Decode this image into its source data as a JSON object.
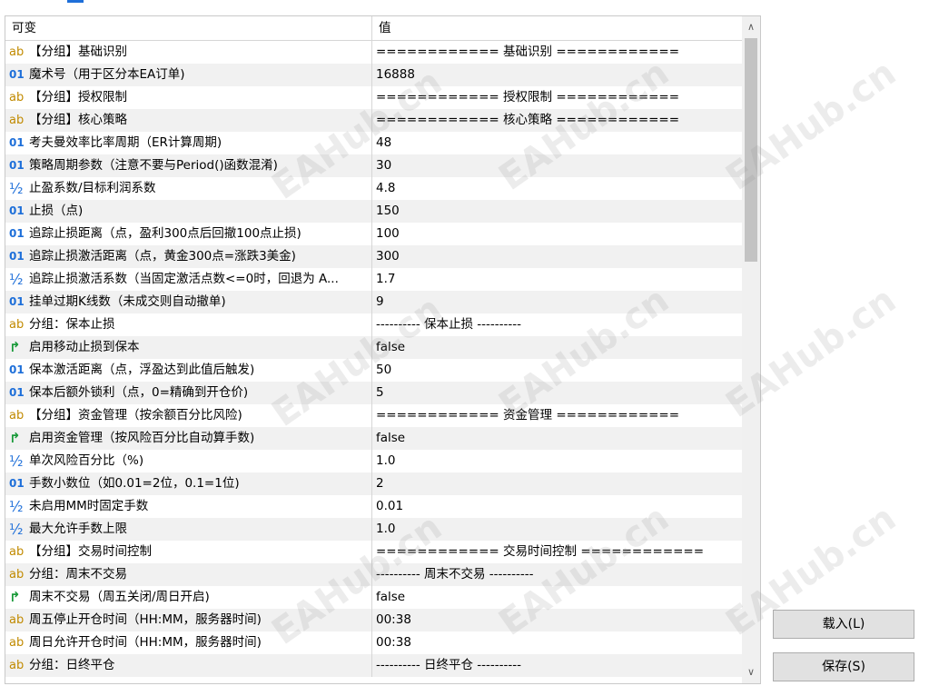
{
  "header": {
    "col_name": "可变",
    "col_value": "值"
  },
  "rows": [
    {
      "type": "ab",
      "icon": "string-icon",
      "name": "【分组】基础识别",
      "value": "============ 基础识别 ============"
    },
    {
      "type": "01",
      "icon": "integer-icon",
      "name": "魔术号（用于区分本EA订单)",
      "value": "16888"
    },
    {
      "type": "ab",
      "icon": "string-icon",
      "name": "【分组】授权限制",
      "value": "============ 授权限制 ============"
    },
    {
      "type": "ab",
      "icon": "string-icon",
      "name": "【分组】核心策略",
      "value": "============ 核心策略 ============"
    },
    {
      "type": "01",
      "icon": "integer-icon",
      "name": "考夫曼效率比率周期（ER计算周期)",
      "value": "48"
    },
    {
      "type": "01",
      "icon": "integer-icon",
      "name": "策略周期参数（注意不要与Period()函数混淆)",
      "value": "30"
    },
    {
      "type": "half",
      "icon": "double-icon",
      "name": "止盈系数/目标利润系数",
      "value": "4.8"
    },
    {
      "type": "01",
      "icon": "integer-icon",
      "name": "止损（点)",
      "value": "150"
    },
    {
      "type": "01",
      "icon": "integer-icon",
      "name": "追踪止损距离（点，盈利300点后回撤100点止损)",
      "value": "100"
    },
    {
      "type": "01",
      "icon": "integer-icon",
      "name": "追踪止损激活距离（点，黄金300点=涨跌3美金)",
      "value": "300"
    },
    {
      "type": "half",
      "icon": "double-icon",
      "name": "追踪止损激活系数（当固定激活点数<=0时，回退为 A...",
      "value": "1.7"
    },
    {
      "type": "01",
      "icon": "integer-icon",
      "name": "挂单过期K线数（未成交则自动撤单)",
      "value": "9"
    },
    {
      "type": "ab",
      "icon": "string-icon",
      "name": "分组：保本止损",
      "value": "---------- 保本止损 ----------"
    },
    {
      "type": "bool",
      "icon": "bool-icon",
      "name": "启用移动止损到保本",
      "value": "false"
    },
    {
      "type": "01",
      "icon": "integer-icon",
      "name": "保本激活距离（点，浮盈达到此值后触发)",
      "value": "50"
    },
    {
      "type": "01",
      "icon": "integer-icon",
      "name": "保本后额外锁利（点，0=精确到开仓价)",
      "value": "5"
    },
    {
      "type": "ab",
      "icon": "string-icon",
      "name": "【分组】资金管理（按余额百分比风险)",
      "value": "============ 资金管理 ============"
    },
    {
      "type": "bool",
      "icon": "bool-icon",
      "name": "启用资金管理（按风险百分比自动算手数)",
      "value": "false"
    },
    {
      "type": "half",
      "icon": "double-icon",
      "name": "单次风险百分比（%)",
      "value": "1.0"
    },
    {
      "type": "01",
      "icon": "integer-icon",
      "name": "手数小数位（如0.01=2位，0.1=1位)",
      "value": "2"
    },
    {
      "type": "half",
      "icon": "double-icon",
      "name": "未启用MM时固定手数",
      "value": "0.01"
    },
    {
      "type": "half",
      "icon": "double-icon",
      "name": "最大允许手数上限",
      "value": "1.0"
    },
    {
      "type": "ab",
      "icon": "string-icon",
      "name": "【分组】交易时间控制",
      "value": "============ 交易时间控制 ============"
    },
    {
      "type": "ab",
      "icon": "string-icon",
      "name": "分组：周末不交易",
      "value": "---------- 周末不交易 ----------"
    },
    {
      "type": "bool",
      "icon": "bool-icon",
      "name": "周末不交易（周五关闭/周日开启)",
      "value": "false"
    },
    {
      "type": "ab",
      "icon": "string-icon",
      "name": "周五停止开仓时间（HH:MM，服务器时间)",
      "value": "00:38"
    },
    {
      "type": "ab",
      "icon": "string-icon",
      "name": "周日允许开仓时间（HH:MM，服务器时间)",
      "value": "00:38"
    },
    {
      "type": "ab",
      "icon": "string-icon",
      "name": "分组：日终平仓",
      "value": "---------- 日终平仓 ----------"
    }
  ],
  "icon_glyphs": {
    "ab": "ab",
    "01": "01",
    "half": "½",
    "bool": "↱"
  },
  "buttons": {
    "load": "载入(L)",
    "save": "保存(S)"
  },
  "watermark": "EAHub.cn"
}
